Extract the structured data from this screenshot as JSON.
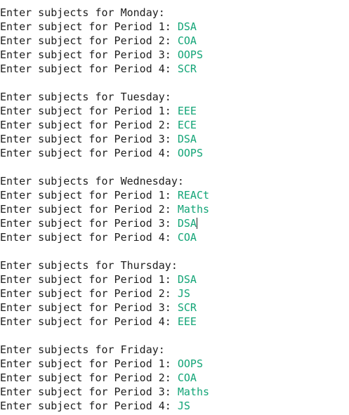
{
  "colors": {
    "prompt_text": "#1e1e1e",
    "input_text": "#13a577",
    "background": "#ffffff"
  },
  "console": {
    "days": [
      {
        "header": "Enter subjects for Monday:",
        "periods": [
          {
            "prompt": "Enter subject for Period 1: ",
            "value": "DSA"
          },
          {
            "prompt": "Enter subject for Period 2: ",
            "value": "COA"
          },
          {
            "prompt": "Enter subject for Period 3: ",
            "value": "OOPS"
          },
          {
            "prompt": "Enter subject for Period 4: ",
            "value": "SCR"
          }
        ]
      },
      {
        "header": "Enter subjects for Tuesday:",
        "periods": [
          {
            "prompt": "Enter subject for Period 1: ",
            "value": "EEE"
          },
          {
            "prompt": "Enter subject for Period 2: ",
            "value": "ECE"
          },
          {
            "prompt": "Enter subject for Period 3: ",
            "value": "DSA"
          },
          {
            "prompt": "Enter subject for Period 4: ",
            "value": "OOPS"
          }
        ]
      },
      {
        "header": "Enter subjects for Wednesday:",
        "periods": [
          {
            "prompt": "Enter subject for Period 1: ",
            "value": "REACt"
          },
          {
            "prompt": "Enter subject for Period 2: ",
            "value": "Maths"
          },
          {
            "prompt": "Enter subject for Period 3: ",
            "value": "DSA",
            "cursor": true
          },
          {
            "prompt": "Enter subject for Period 4: ",
            "value": "COA"
          }
        ]
      },
      {
        "header": "Enter subjects for Thursday:",
        "periods": [
          {
            "prompt": "Enter subject for Period 1: ",
            "value": "DSA"
          },
          {
            "prompt": "Enter subject for Period 2: ",
            "value": "JS"
          },
          {
            "prompt": "Enter subject for Period 3: ",
            "value": "SCR"
          },
          {
            "prompt": "Enter subject for Period 4: ",
            "value": "EEE"
          }
        ]
      },
      {
        "header": "Enter subjects for Friday:",
        "periods": [
          {
            "prompt": "Enter subject for Period 1: ",
            "value": "OOPS"
          },
          {
            "prompt": "Enter subject for Period 2: ",
            "value": "COA"
          },
          {
            "prompt": "Enter subject for Period 3: ",
            "value": "Maths"
          },
          {
            "prompt": "Enter subject for Period 4: ",
            "value": "JS"
          }
        ]
      }
    ]
  }
}
